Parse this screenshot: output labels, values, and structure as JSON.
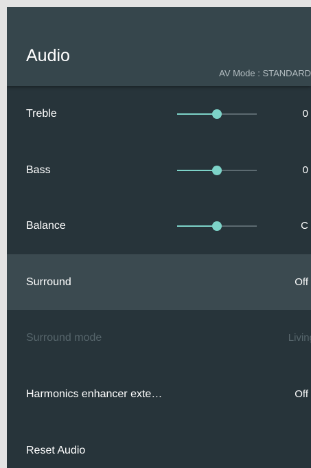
{
  "header": {
    "title": "Audio",
    "av_mode": "AV Mode : STANDARD"
  },
  "colors": {
    "accent": "#7dd3c8",
    "panel_bg": "#27343a",
    "header_bg": "#36464c",
    "focused_row_bg": "#3b4a50"
  },
  "items": [
    {
      "label": "Treble",
      "value": "0",
      "slider_fraction": 0.5
    },
    {
      "label": "Bass",
      "value": "0",
      "slider_fraction": 0.5
    },
    {
      "label": "Balance",
      "value": "C",
      "slider_fraction": 0.5
    },
    {
      "label": "Surround",
      "value": "Off",
      "focused": true
    },
    {
      "label": "Surround mode",
      "value": "Living",
      "disabled": true
    },
    {
      "label": "Harmonics enhancer exte…",
      "value": "Off"
    },
    {
      "label": "Reset Audio",
      "value": ""
    }
  ]
}
